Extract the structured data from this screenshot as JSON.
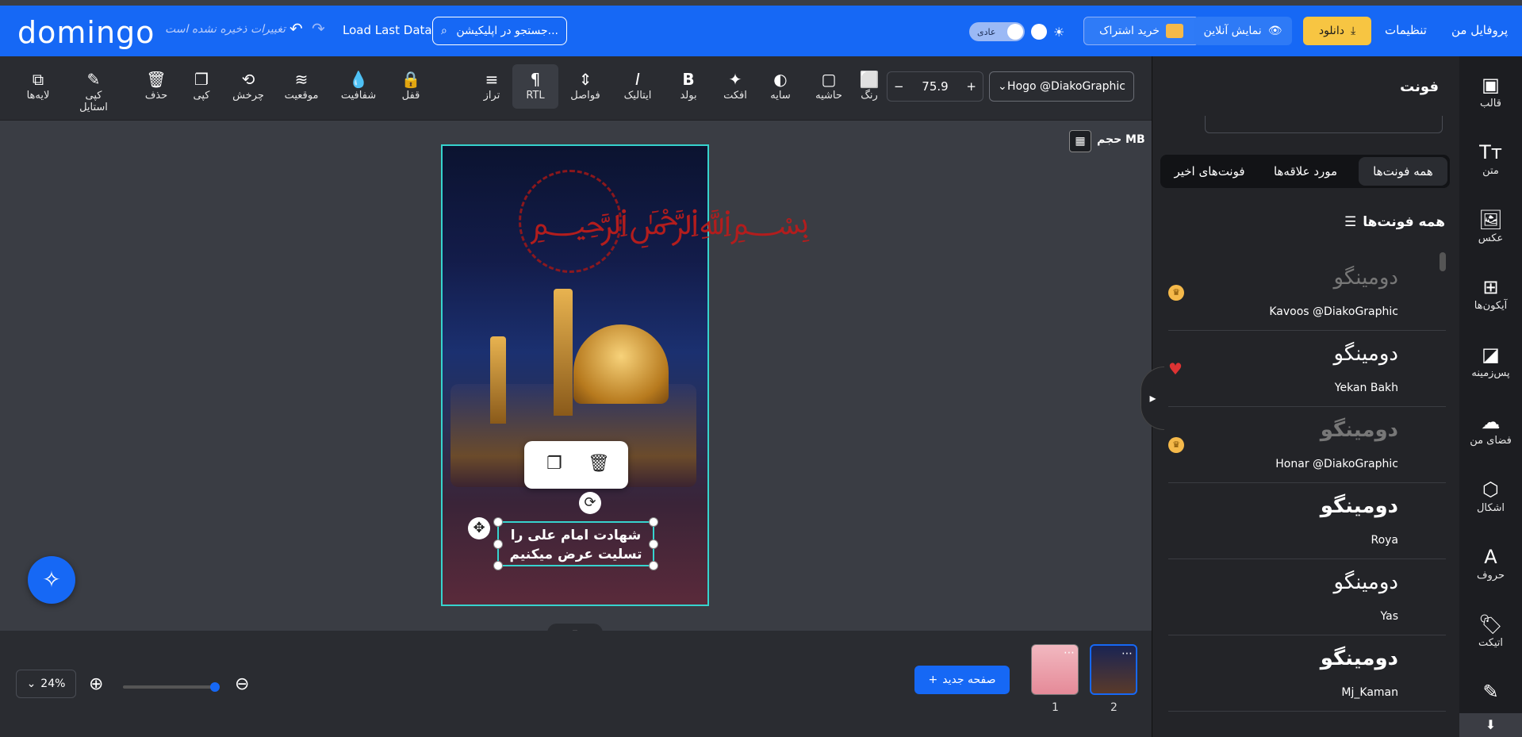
{
  "header": {
    "logo": "domingo",
    "unsaved_text": "تغییرات ذخیره نشده است",
    "load_last": "Load Last Data",
    "search_placeholder": "جستجو در اپلیکیشن...",
    "theme_label": "عادی",
    "subscribe": "خرید اشتراک",
    "online_view": "نمایش آنلاین",
    "download": "دانلود",
    "settings": "تنظیمات",
    "profile": "پروفایل من"
  },
  "toolbar": {
    "layers": "لایه‌ها",
    "copy_style": "کپی استایل",
    "delete": "حذف",
    "copy": "کپی",
    "rotate": "چرخش",
    "position": "موقعیت",
    "opacity": "شفافیت",
    "lock": "قفل",
    "align": "تراز",
    "rtl": "RTL",
    "spacing": "فواصل",
    "italic": "ایتالیک",
    "bold": "بولد",
    "effect": "افکت",
    "shadow": "سایه",
    "border": "حاشیه",
    "color": "رنگ",
    "font_size": "75.9",
    "font_name": "Hogo @DiakoGraphic"
  },
  "canvas": {
    "size_label": "حجم MB",
    "text_line1": "شهادت امام علی را",
    "text_line2": "تسلیت عرض میکنیم"
  },
  "bottom": {
    "zoom": "24%",
    "new_page": "صفحه جدید",
    "pages": [
      {
        "num": "1"
      },
      {
        "num": "2"
      }
    ]
  },
  "panel": {
    "title": "فونت",
    "tabs": [
      "همه فونت‌ها",
      "مورد علاقه‌ها",
      "فونت‌های اخیر"
    ],
    "section": "همه فونت‌ها",
    "fonts": [
      {
        "preview": "دومینگو",
        "name": "Kavoos @DiakoGraphic",
        "badge": "pro"
      },
      {
        "preview": "دومینگو",
        "name": "Yekan Bakh",
        "badge": "heart"
      },
      {
        "preview": "دومینگو",
        "name": "Honar @DiakoGraphic",
        "badge": "pro"
      },
      {
        "preview": "دومینگو",
        "name": "Roya",
        "badge": ""
      },
      {
        "preview": "دومینگو",
        "name": "Yas",
        "badge": ""
      },
      {
        "preview": "دومینگو",
        "name": "Mj_Kaman",
        "badge": ""
      }
    ]
  },
  "rail": [
    "قالب",
    "متن",
    "عکس",
    "آیکون‌ها",
    "پس‌زمینه",
    "فضای من",
    "اشکال",
    "حروف",
    "اتیکت"
  ],
  "colors": {
    "brand": "#1668f5",
    "accent": "#36d3ce",
    "download": "#f7c542"
  }
}
